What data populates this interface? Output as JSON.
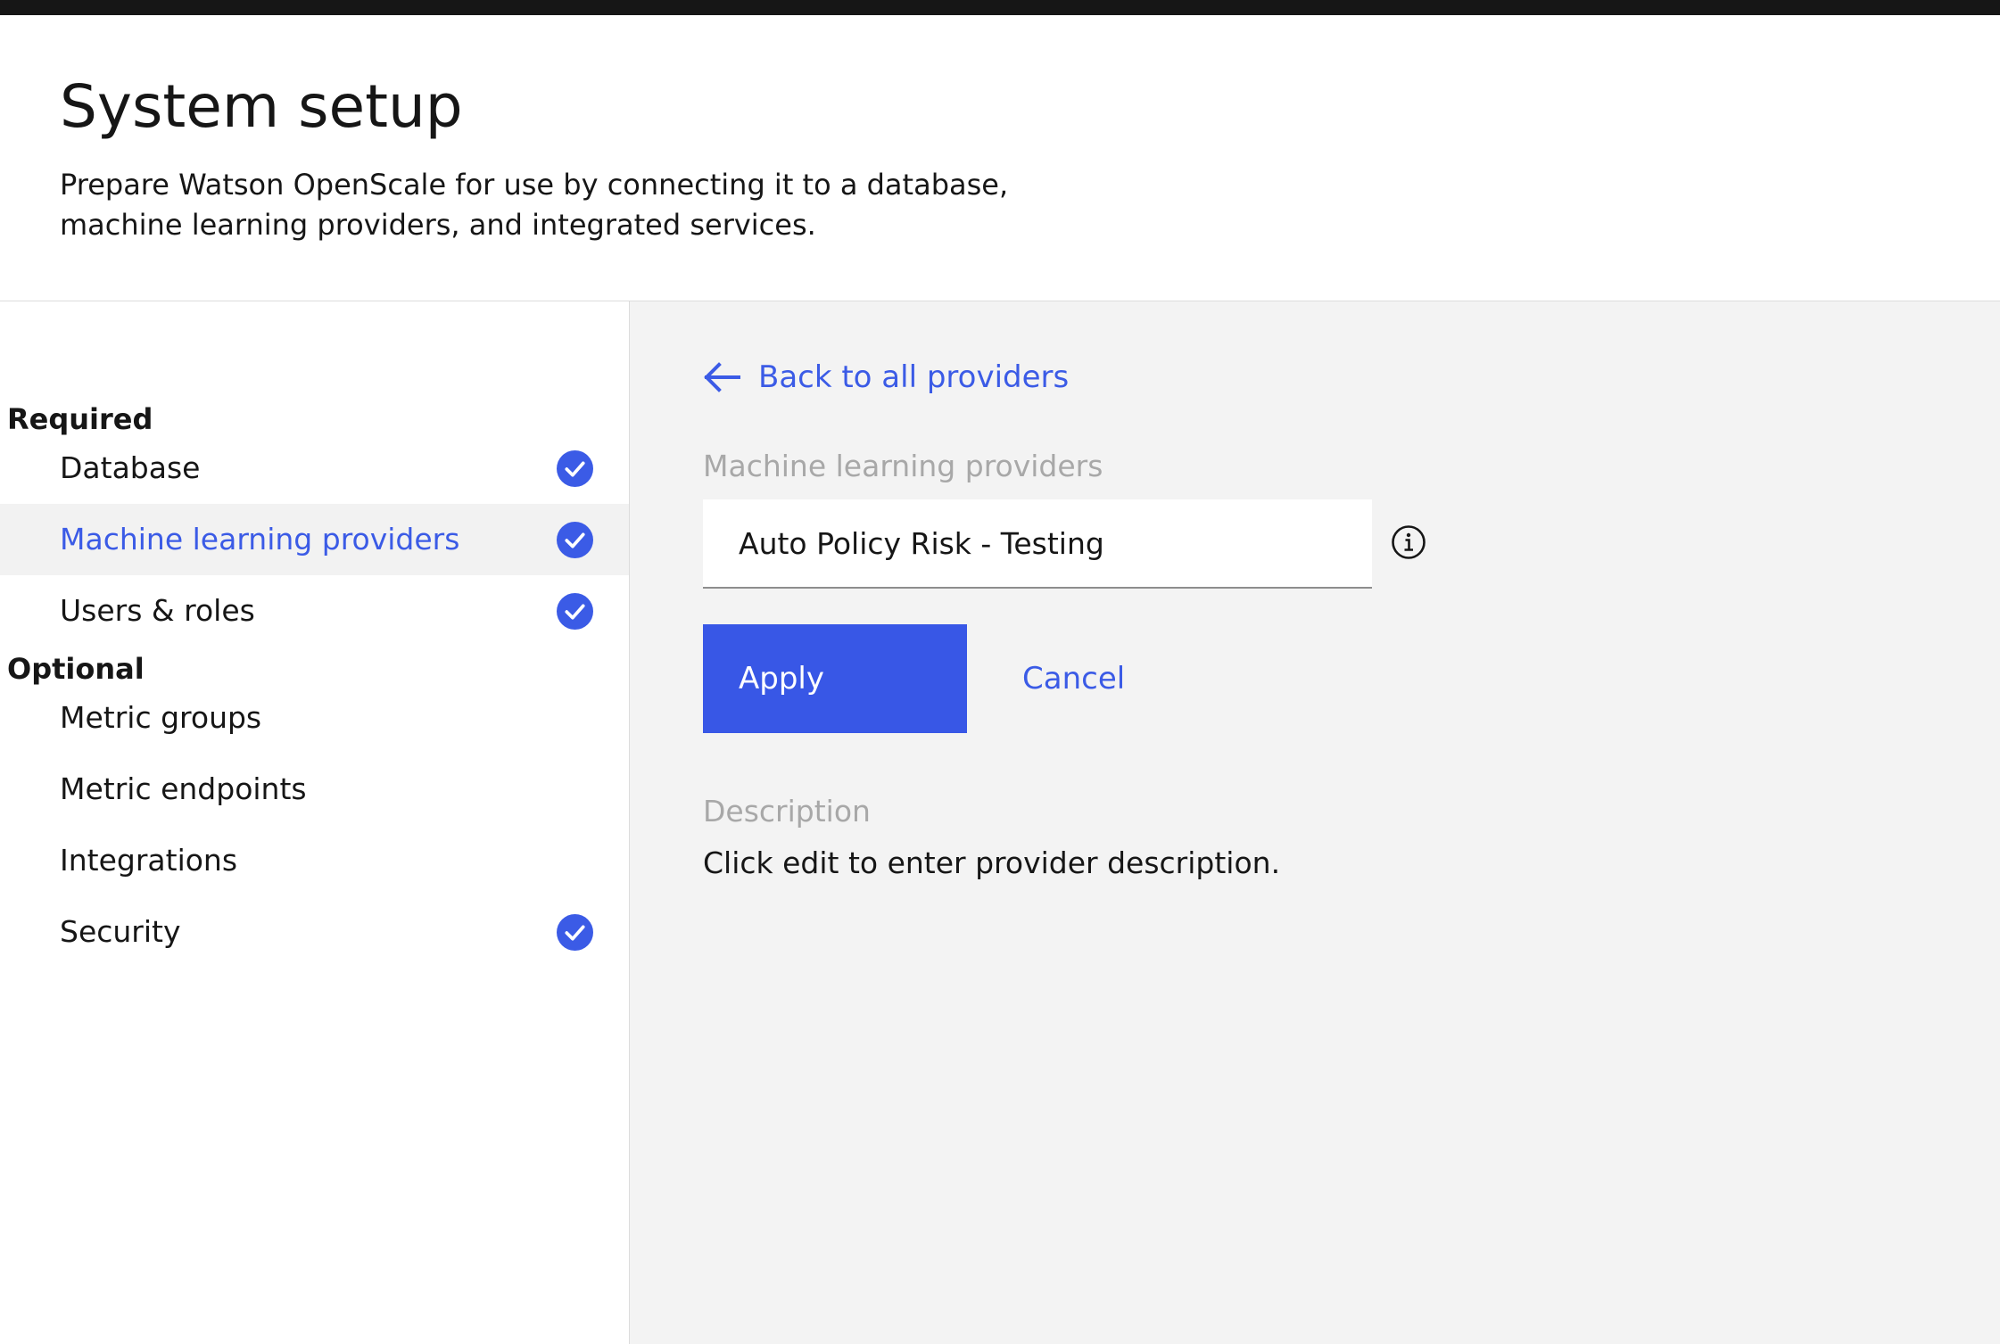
{
  "header": {
    "title": "System setup",
    "subtitle": "Prepare Watson OpenScale for use by connecting it to a database, machine learning providers, and integrated services."
  },
  "sidebar": {
    "required_heading": "Required",
    "optional_heading": "Optional",
    "items": [
      {
        "label": "Database",
        "completed": true,
        "active": false
      },
      {
        "label": "Machine learning providers",
        "completed": true,
        "active": true
      },
      {
        "label": "Users & roles",
        "completed": true,
        "active": false
      },
      {
        "label": "Metric groups",
        "completed": false,
        "active": false
      },
      {
        "label": "Metric endpoints",
        "completed": false,
        "active": false
      },
      {
        "label": "Integrations",
        "completed": false,
        "active": false
      },
      {
        "label": "Security",
        "completed": true,
        "active": false
      }
    ]
  },
  "main": {
    "back_link": "Back to all providers",
    "provider_field_label": "Machine learning providers",
    "provider_name_value": "Auto Policy Risk - Testing",
    "apply_label": "Apply",
    "cancel_label": "Cancel",
    "description_label": "Description",
    "description_text": "Click edit to enter provider description."
  },
  "colors": {
    "accent": "#3b5be6",
    "button_primary": "#3857e6",
    "topbar": "#161616",
    "main_background": "#f3f3f3",
    "muted_label": "#a8a8a8"
  },
  "icons": {
    "back": "arrow-left-icon",
    "completed": "checkmark-filled-icon",
    "info": "information-icon"
  }
}
